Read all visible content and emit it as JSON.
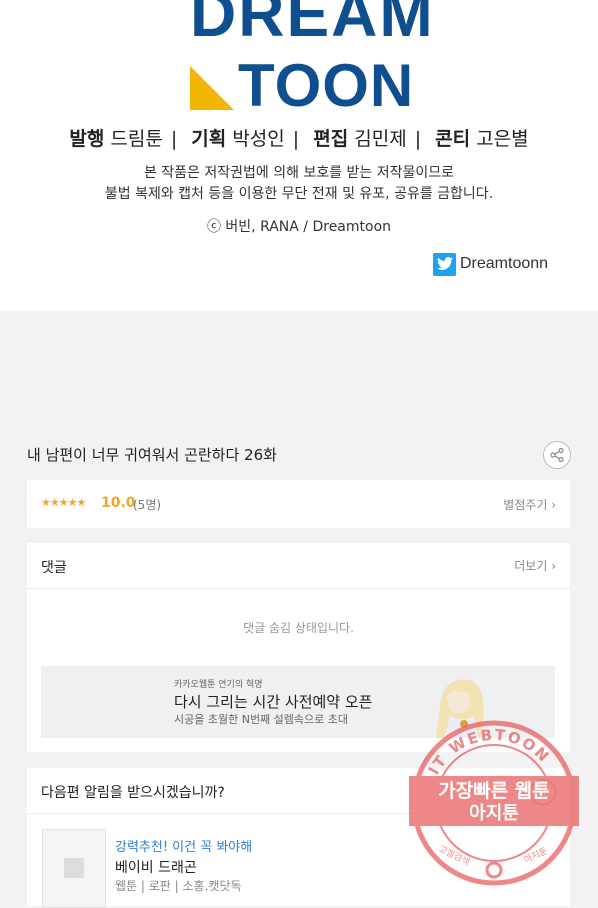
{
  "header": {
    "logo_line1": "DREAM",
    "logo_line2": "TOON",
    "credits": [
      {
        "role": "발행",
        "name": "드림툰"
      },
      {
        "role": "기획",
        "name": "박성인"
      },
      {
        "role": "편집",
        "name": "김민제"
      },
      {
        "role": "콘티",
        "name": "고은별"
      }
    ],
    "notice_line1": "본 작품은 저작권법에 의해 보호를 받는 저작물이므로",
    "notice_line2": "불법 복제와 캡처 등을 이용한 무단 전재 및 유포, 공유를 금합니다.",
    "copyright": "ⓒ 버빈, RANA / Dreamtoon",
    "twitter_handle": "Dreamtoonn"
  },
  "episode": {
    "title": "내 남편이 너무 귀여워서 곤란하다 26화"
  },
  "rating": {
    "stars": "★★★★★",
    "score": "10.0",
    "count": "(5명)",
    "rate_button": "별점주기 ›"
  },
  "comments": {
    "title": "댓글",
    "more": "더보기 ›",
    "hidden_notice": "댓글 숨김 상태입니다.",
    "banner": {
      "sub": "카카오웹툰 연기의 혁명",
      "title": "다시 그리는 시간 사전예약 오픈",
      "desc": "시공을 초월한 N번째 설렘속으로 초대"
    }
  },
  "notify": {
    "title": "다음편 알림을 받으시겠습니까?",
    "recommend_label": "강력추천! 이건 꼭 봐야해",
    "recommend_title": "베이비 드래곤",
    "recommend_genre": "웹툰 | 로판 | 소홍,캣닷독"
  },
  "watermark": {
    "ring_text": "AGIT WEBTOON",
    "line1": "가장빠른 웹툰",
    "line2": "아지툰",
    "bottom_left": "고퀄검색",
    "bottom_right": "아지툰"
  },
  "colors": {
    "brand_blue": "#0f4f8f",
    "brand_yellow": "#f2b705",
    "star": "#f5a623",
    "link_blue": "#2f7fd6",
    "stamp_red": "#e85a5a"
  }
}
